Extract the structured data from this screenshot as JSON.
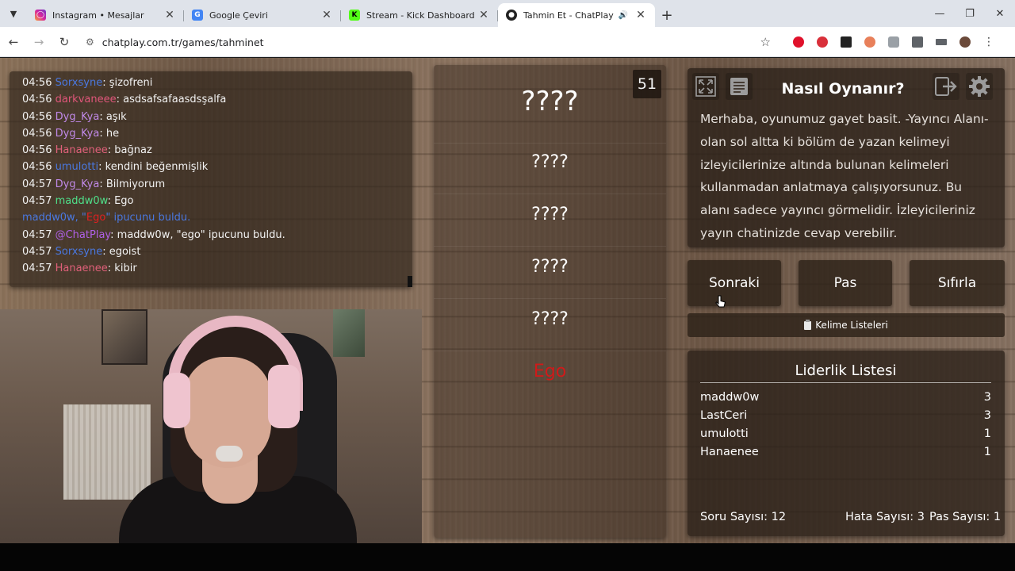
{
  "browser": {
    "tabs": [
      {
        "title": "Instagram • Mesajlar",
        "icon": "instagram-icon",
        "color": "#d6249f"
      },
      {
        "title": "Google Çeviri",
        "icon": "google-translate-icon",
        "color": "#4285f4"
      },
      {
        "title": "Stream - Kick Dashboard",
        "icon": "kick-icon",
        "color": "#53fc18"
      },
      {
        "title": "Tahmin Et - ChatPlay",
        "icon": "chatplay-icon",
        "color": "#222222",
        "active": true
      }
    ],
    "url": "chatplay.com.tr/games/tahminet"
  },
  "chat": {
    "lines": [
      {
        "time": "04:56",
        "user": "Sorxsyne",
        "color": "#4a78e0",
        "message": ": şizofreni"
      },
      {
        "time": "04:56",
        "user": "darkvaneee",
        "color": "#e0567a",
        "message": ": asdsafsafaasdsşalfa"
      },
      {
        "time": "04:56",
        "user": "Dyg_Kya",
        "color": "#c089e8",
        "message": ": aşık"
      },
      {
        "time": "04:56",
        "user": "Dyg_Kya",
        "color": "#c089e8",
        "message": ": he"
      },
      {
        "time": "04:56",
        "user": "Hanaenee",
        "color": "#e0607a",
        "message": ": bağnaz"
      },
      {
        "time": "04:56",
        "user": "umulotti",
        "color": "#4a78e0",
        "message": ": kendini beğenmişlik"
      },
      {
        "time": "04:57",
        "user": "Dyg_Kya",
        "color": "#c089e8",
        "message": ": Bilmiyorum"
      },
      {
        "time": "04:57",
        "user": "maddw0w",
        "color": "#4fe08a",
        "message": ": Ego"
      },
      {
        "system": true,
        "p1": "maddw0w, \"",
        "p2": "Ego",
        "p3": "\" ipucunu buldu."
      },
      {
        "time": "04:57",
        "user": "@ChatPlay",
        "color": "#b060e8",
        "message": ": maddw0w, \"ego\" ipucunu buldu."
      },
      {
        "time": "04:57",
        "user": "Sorxsyne",
        "color": "#4a78e0",
        "message": ": egoist"
      },
      {
        "time": "04:57",
        "user": "Hanaenee",
        "color": "#e0607a",
        "message": ": kibir"
      }
    ]
  },
  "game": {
    "counter": "51",
    "main_word": "????",
    "words": [
      "????",
      "????",
      "????",
      "????"
    ],
    "found_word": "Ego",
    "found_color": "#d01a1a"
  },
  "howto": {
    "title": "Nasıl Oynanır?",
    "text": "Merhaba, oyunumuz gayet basit. -Yayıncı Alanı- olan sol altta ki bölüm de yazan kelimeyi izleyicilerinize altında bulunan kelimeleri kullanmadan anlatmaya çalışıyorsunuz. Bu alanı sadece yayıncı görmelidir. İzleyicileriniz yayın chatinizde cevap verebilir."
  },
  "actions": {
    "next": "Sonraki",
    "pass": "Pas",
    "reset": "Sıfırla",
    "word_lists": "Kelime Listeleri"
  },
  "leaderboard": {
    "title": "Liderlik Listesi",
    "rows": [
      {
        "name": "maddw0w",
        "score": "3"
      },
      {
        "name": "LastCeri",
        "score": "3"
      },
      {
        "name": "umulotti",
        "score": "1"
      },
      {
        "name": "Hanaenee",
        "score": "1"
      }
    ],
    "questions": "Soru Sayısı: 12",
    "errors": "Hata Sayısı: 3",
    "passes": "Pas Sayısı: 1"
  }
}
